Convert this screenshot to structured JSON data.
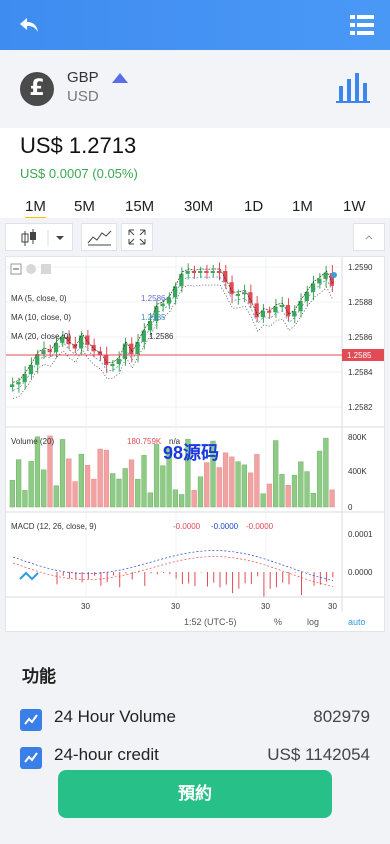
{
  "pair": {
    "base": "GBP",
    "quote": "USD",
    "coin_symbol": "£"
  },
  "price": {
    "value": "US$ 1.2713",
    "change": "US$ 0.0007 (0.05%)"
  },
  "timeframes": [
    {
      "label": "1M",
      "active": true
    },
    {
      "label": "5M"
    },
    {
      "label": "15M"
    },
    {
      "label": "30M"
    },
    {
      "label": "1D"
    },
    {
      "label": "1M"
    },
    {
      "label": "1W"
    }
  ],
  "chart": {
    "watermark": "98源码",
    "legend_ma5": "MA (5, close, 0)",
    "legend_ma10": "MA (10, close, 0)",
    "legend_ma20": "MA (20, close, 0)",
    "ma5_value": "1.2586",
    "ma10_value": "1.2585",
    "ma20_value": "1.2586",
    "volume_label": "Volume (20)",
    "volume_value": "180.759K",
    "volume_na": "n/a",
    "macd_label": "MACD (12, 26, close, 9)",
    "macd_v1": "-0.0000",
    "macd_v2": "-0.0000",
    "macd_v3": "-0.0000",
    "price_ticks": [
      "1.2590",
      "1.2588",
      "1.2586",
      "1.2584",
      "1.2582"
    ],
    "current_price": "1.2585",
    "volume_ticks": [
      "800K",
      "400K",
      "0"
    ],
    "macd_ticks": [
      "0.0001",
      "0.0000"
    ],
    "x_ticks": [
      "30",
      "30",
      "30",
      "30"
    ],
    "time_label": "1:52 (UTC-5)",
    "pct_label": "%",
    "log_label": "log",
    "auto_label": "auto"
  },
  "features": {
    "title": "功能",
    "rows": [
      {
        "label": "24 Hour Volume",
        "value": "802979"
      },
      {
        "label": "24-hour credit",
        "value": "US$ 1142054"
      }
    ],
    "cta": "預約"
  },
  "colors": {
    "header": "#4a98f6",
    "accent": "#27c089",
    "up": "#3aa853",
    "down": "#e04b55"
  }
}
